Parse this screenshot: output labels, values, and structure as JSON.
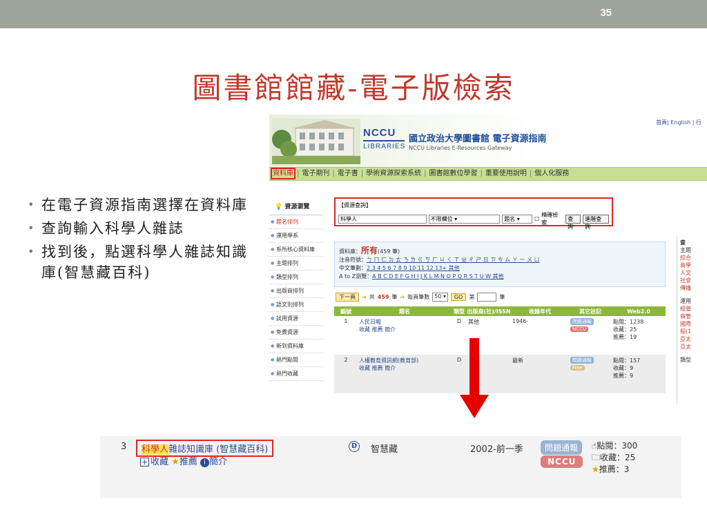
{
  "slide": {
    "number": "35",
    "title": "圖書館館藏-電子版檢索",
    "bullets": [
      "在電子資源指南選擇在資料庫",
      "查詢輸入科學人雜誌",
      "找到後，點選科學人雜誌知識庫(智慧藏百科)"
    ]
  },
  "screenshot": {
    "top_links": "首頁| English | 行",
    "logo_ncc": "NCCU",
    "logo_lib": "LIBRARIES",
    "site_title": "國立政治大學圖書館 電子資源指南",
    "site_subtitle": "NCCU Libraries E-Resources Gateway",
    "nav": [
      "資料庫",
      "電子期刊",
      "電子書",
      "學術資源探索系統",
      "圖書館數位學習",
      "重要使用說明",
      "個人化服務"
    ],
    "sidebar": {
      "heading": "資源瀏覽",
      "items": [
        "題名排列",
        "運用學系",
        "系所核心資料庫",
        "主題排列",
        "類型排列",
        "出版商排列",
        "語文別排列",
        "試用資源",
        "免費資源",
        "新到資料庫",
        "熱門點閱",
        "熱門收藏"
      ]
    },
    "search": {
      "heading": "【資源查詢】",
      "query": "科學人",
      "field_select": "不限欄位",
      "type_select": "題名",
      "precise_label": "精確檢索",
      "search_btn": "查詢",
      "advanced_btn": "進階查詢"
    },
    "info": {
      "db_label": "資料庫：",
      "db_all": "所有",
      "db_count": "(459 筆)",
      "phonetic_label": "注音符號：",
      "phonetic": "ㄅ ㄇ ㄈ ㄉ ㄊ ㄋ ㄌ ㄍ ㄎ ㄏ ㄐ ㄑ ㄒ ㄓ ㄔ ㄕ ㄖ ㄗ ㄘ ㄙ ㄚ ㄧ ㄨ ㄩ",
      "strokes_label": "中文筆劃：",
      "strokes": "2 3 4 5 6 7 8 9 10 11 12 13+ 其他",
      "az_label": "A to Z瀏覽：",
      "az": "A B C D E F G H I J K L M N O P Q R S T U W 其他"
    },
    "pager": {
      "next": "下一頁",
      "total_pre": "共",
      "total": "459",
      "total_post": "筆",
      "per_page_label": "每頁筆數",
      "per_page": "50",
      "go": "GO",
      "page_pre": "第",
      "page_post": "筆"
    },
    "table": {
      "headers": [
        "編號",
        "題名",
        "類型",
        "出版商(社)/ISSN",
        "收錄年代",
        "其它註記",
        "Web2.0"
      ],
      "rows": [
        {
          "no": "1",
          "title": "人民日報",
          "actions": "收藏 推薦 簡介",
          "type": "D",
          "publisher": "其他",
          "years": "1946-",
          "report": "問題通報",
          "tag": "NCCU",
          "stats": [
            "點閱：1238",
            "收藏：25",
            "推薦：19"
          ]
        },
        {
          "no": "2",
          "title": "人權教育資訊網(教育部)",
          "actions": "收藏 推薦 簡介",
          "type": "D",
          "publisher": "",
          "years": "最新",
          "report": "問題通報",
          "tag": "Free",
          "stats": [
            "點閱：157",
            "收藏：9",
            "推薦：9"
          ]
        }
      ]
    },
    "right_panel": {
      "head": "查",
      "items": [
        "主題",
        "綜合",
        "商學",
        "人文",
        "社會",
        "傳播",
        "運用",
        "經營",
        "商管",
        "國際",
        "程(1",
        "亞太",
        "亞太",
        "類型"
      ]
    }
  },
  "zoom_row": {
    "no": "3",
    "title_highlight": "科學人",
    "title_rest": "雜誌知識庫 (智慧藏百科)",
    "collect": "收藏",
    "recommend": "推薦",
    "intro": "簡介",
    "type": "D",
    "publisher": "智慧藏",
    "years": "2002-前一季",
    "report": "問題通報",
    "tag": "NCCU",
    "stats": [
      "點閱：300",
      "收藏：25",
      "推薦：3"
    ]
  },
  "colors": {
    "title_red": "#c0392b",
    "top_bar": "#9da59a",
    "nav_green": "#c7df95",
    "arrow_red": "#e60000",
    "highlight_border": "#e02424"
  }
}
